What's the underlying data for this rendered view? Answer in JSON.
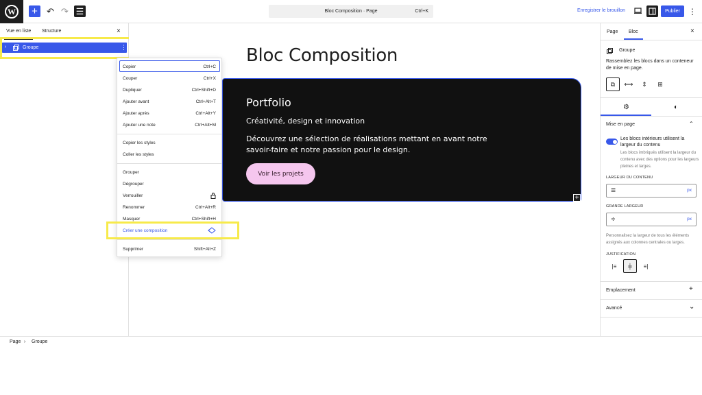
{
  "topbar": {
    "wp_logo": "W",
    "add_icon": "plus-icon",
    "undo_icon": "undo-icon",
    "redo_icon": "redo-icon",
    "document_overview_icon": "list-view-icon",
    "command_title": "Bloc Composition · Page",
    "command_shortcut": "Ctrl+K",
    "save_draft": "Enregistrer le brouillon",
    "publish": "Publier"
  },
  "left_panel": {
    "tabs": [
      "Vue en liste",
      "Structure"
    ],
    "close": "×",
    "group_label": "Groupe"
  },
  "editor": {
    "title": "Bloc Composition",
    "block": {
      "heading": "Portfolio",
      "subheading": "Créativité, design et innovation",
      "text": "Découvrez une sélection de réalisations mettant en avant notre savoir-faire et notre passion pour le design.",
      "button": "Voir les projets"
    }
  },
  "context_menu": {
    "group1": [
      {
        "label": "Copier",
        "shortcut": "Ctrl+C"
      },
      {
        "label": "Couper",
        "shortcut": "Ctrl+X"
      },
      {
        "label": "Dupliquer",
        "shortcut": "Ctrl+Shift+D"
      },
      {
        "label": "Ajouter avant",
        "shortcut": "Ctrl+Alt+T"
      },
      {
        "label": "Ajouter après",
        "shortcut": "Ctrl+Alt+Y"
      },
      {
        "label": "Ajouter une note",
        "shortcut": "Ctrl+Alt+M"
      }
    ],
    "group2": [
      {
        "label": "Copier les styles"
      },
      {
        "label": "Coller les styles"
      }
    ],
    "group3": [
      {
        "label": "Grouper"
      },
      {
        "label": "Dégrouper"
      },
      {
        "label": "Verrouiller"
      },
      {
        "label": "Renommer",
        "shortcut": "Ctrl+Alt+R"
      },
      {
        "label": "Masquer",
        "shortcut": "Ctrl+Shift+H"
      },
      {
        "label": "Créer une composition"
      }
    ],
    "group4": [
      {
        "label": "Supprimer",
        "shortcut": "Shift+Alt+Z"
      }
    ]
  },
  "right_panel": {
    "tabs": [
      "Page",
      "Bloc"
    ],
    "close": "×",
    "block_name": "Groupe",
    "block_desc": "Rassemblez les blocs dans un conteneur de mise en page.",
    "layout": {
      "title": "Mise en page",
      "toggle_label": "Les blocs intérieurs utilisent la largeur du contenu",
      "toggle_on": true,
      "help": "Les blocs imbriqués utilisent la largeur du contenu avec des options pour les largeurs pleines et larges.",
      "content_width_label": "Largeur du contenu",
      "content_width_unit": "px",
      "wide_width_label": "Grande largeur",
      "wide_width_unit": "px",
      "width_help": "Personnalisez la largeur de tous les éléments assignés aux colonnes centrales ou larges.",
      "justification_label": "Justification"
    },
    "sections": [
      "Emplacement",
      "Avancé"
    ]
  },
  "breadcrumb": [
    "Page",
    "Groupe"
  ],
  "colors": {
    "accent": "#3858e9",
    "highlight": "#f7ea4a",
    "dark_block": "#111111",
    "button_pink": "#f5c6ee"
  }
}
